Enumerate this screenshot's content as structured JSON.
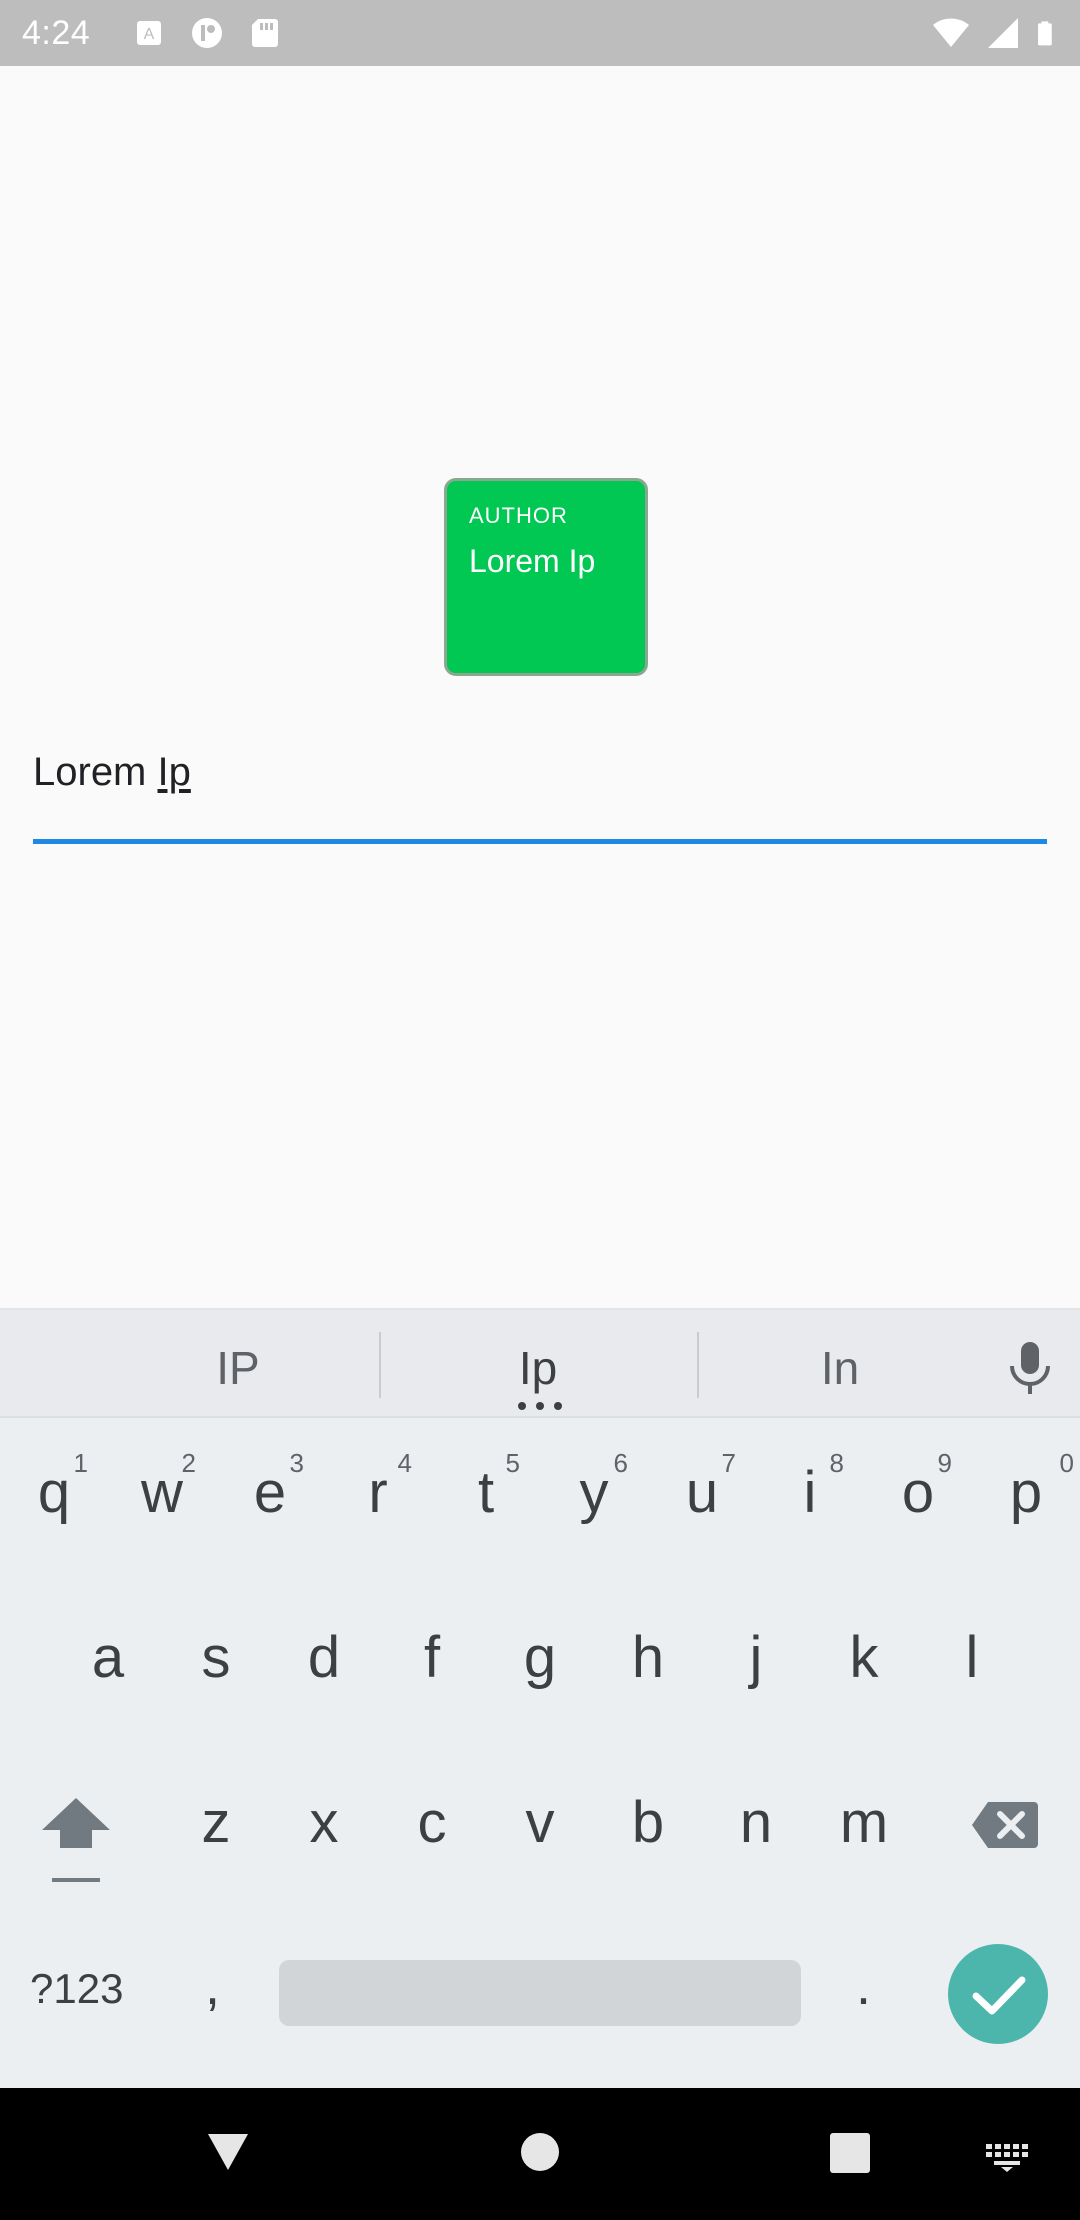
{
  "status_bar": {
    "time": "4:24",
    "left_icons": [
      "text-recognition-icon",
      "notification-app-icon",
      "sd-card-icon"
    ],
    "right_icons": [
      "wifi-icon",
      "cell-signal-icon",
      "battery-icon"
    ]
  },
  "author_card": {
    "label": "AUTHOR",
    "name": "Lorem Ip",
    "color": "#00c853"
  },
  "text_field": {
    "value_prefix": "Lorem ",
    "value_composing": "Ip",
    "underline_color": "#1e88e5"
  },
  "keyboard": {
    "suggestions": [
      "IP",
      "Ip",
      "In"
    ],
    "row1": [
      {
        "char": "q",
        "hint": "1"
      },
      {
        "char": "w",
        "hint": "2"
      },
      {
        "char": "e",
        "hint": "3"
      },
      {
        "char": "r",
        "hint": "4"
      },
      {
        "char": "t",
        "hint": "5"
      },
      {
        "char": "y",
        "hint": "6"
      },
      {
        "char": "u",
        "hint": "7"
      },
      {
        "char": "i",
        "hint": "8"
      },
      {
        "char": "o",
        "hint": "9"
      },
      {
        "char": "p",
        "hint": "0"
      }
    ],
    "row2": [
      "a",
      "s",
      "d",
      "f",
      "g",
      "h",
      "j",
      "k",
      "l"
    ],
    "row3": [
      "z",
      "x",
      "c",
      "v",
      "b",
      "n",
      "m"
    ],
    "symbols_label": "?123",
    "comma_label": ",",
    "period_label": ".",
    "enter_color": "#4db6ac"
  },
  "nav_bar": {
    "icons": [
      "back-icon",
      "home-icon",
      "recents-icon",
      "keyboard-switch-icon"
    ]
  }
}
